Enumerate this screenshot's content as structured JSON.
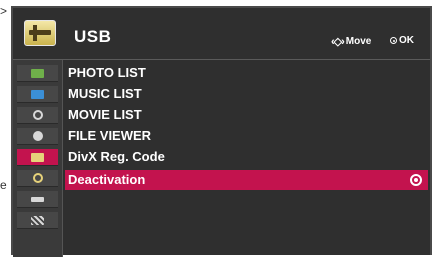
{
  "outside": {
    "edge_letter": "e",
    "arrow_fragment": ">"
  },
  "header": {
    "title": "USB",
    "icon": "usb-plug-icon",
    "hints": {
      "move_label": "Move",
      "move_icon": "four-way-arrow-icon",
      "ok_label": "OK",
      "ok_icon": "ok-button-icon"
    }
  },
  "sidebar": {
    "items": [
      {
        "icon": "picture-icon",
        "color": "#6fb04a"
      },
      {
        "icon": "screen-icon",
        "color": "#3b8fd6"
      },
      {
        "icon": "disc-icon",
        "color": "#d8d8d8"
      },
      {
        "icon": "clock-icon",
        "color": "#d8d8d8"
      },
      {
        "icon": "usb-icon",
        "color": "#e6d27a",
        "active": true
      },
      {
        "icon": "info-icon",
        "color": "#e6d27a"
      },
      {
        "icon": "input-icon",
        "color": "#d8d8d8"
      },
      {
        "icon": "clapper-icon",
        "color": "#d8d8d8"
      }
    ]
  },
  "menu": {
    "items": [
      {
        "label": "PHOTO LIST"
      },
      {
        "label": "MUSIC LIST"
      },
      {
        "label": "MOVIE LIST"
      },
      {
        "label": "FILE VIEWER"
      },
      {
        "label": "DivX Reg. Code"
      },
      {
        "label": "Deactivation",
        "selected": true
      }
    ]
  },
  "colors": {
    "highlight": "#c3134e",
    "panel": "#2f2f2f",
    "text": "#ffffff"
  }
}
